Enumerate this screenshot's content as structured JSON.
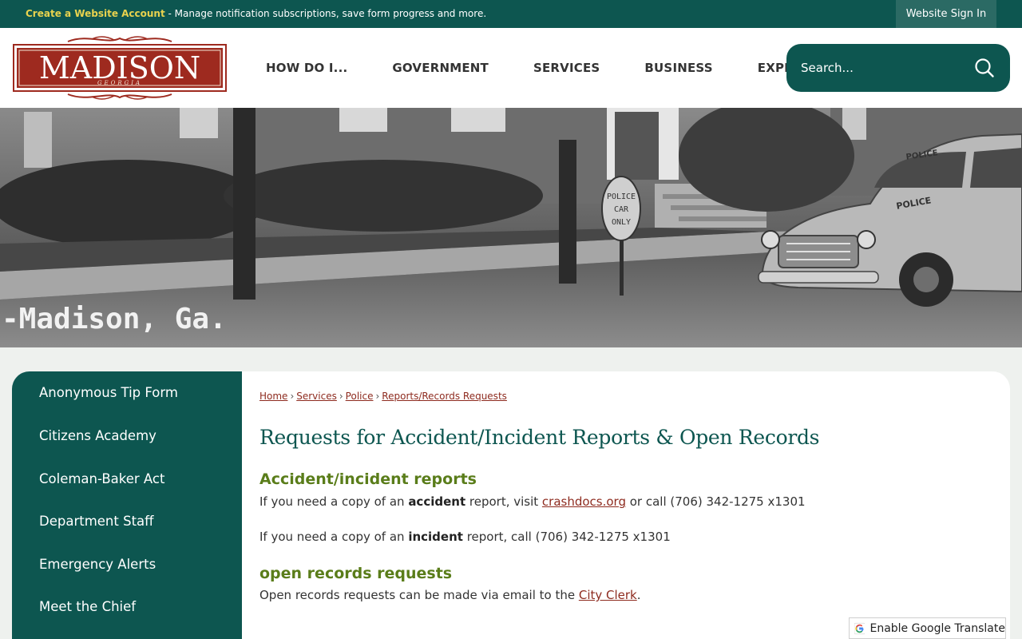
{
  "topbar": {
    "create_account_link": "Create a Website Account",
    "message": " - Manage notification subscriptions, save form progress and more.",
    "sign_in_label": "Website Sign In"
  },
  "logo": {
    "name": "MADISON",
    "subtitle": "GEORGIA",
    "icon": "city-logo"
  },
  "nav": {
    "items": [
      {
        "label": "HOW DO I..."
      },
      {
        "label": "GOVERNMENT"
      },
      {
        "label": "SERVICES"
      },
      {
        "label": "BUSINESS"
      },
      {
        "label": "EXPLORE"
      }
    ]
  },
  "search": {
    "placeholder": "Search...",
    "icon": "search-icon"
  },
  "hero": {
    "caption": "-Madison, Ga.",
    "sign_text": "POLICE CAR ONLY",
    "car_text": "POLICE"
  },
  "sidebar": {
    "items": [
      {
        "label": "Anonymous Tip Form"
      },
      {
        "label": "Citizens Academy"
      },
      {
        "label": "Coleman-Baker Act"
      },
      {
        "label": "Department Staff"
      },
      {
        "label": "Emergency Alerts"
      },
      {
        "label": "Meet the Chief"
      }
    ]
  },
  "breadcrumb": {
    "items": [
      {
        "label": "Home"
      },
      {
        "label": "Services"
      },
      {
        "label": "Police"
      },
      {
        "label": "Reports/Records Requests"
      }
    ],
    "separator": "›"
  },
  "main": {
    "title": "Requests for Accident/Incident Reports & Open Records",
    "section1": {
      "heading": "Accident/incident reports",
      "p1_pre": "If you need a copy of an ",
      "p1_bold": "accident",
      "p1_mid": " report, visit ",
      "p1_link": "crashdocs.org",
      "p1_post": " or call (706) 342-1275 x1301",
      "p2_pre": "If you need a copy of an ",
      "p2_bold": "incident",
      "p2_post": " report, call (706) 342-1275 x1301"
    },
    "section2": {
      "heading": "open records requests",
      "p_pre": "Open records requests can be made via email to the ",
      "p_link": "City Clerk",
      "p_post": "."
    }
  },
  "translate": {
    "label": "Enable Google Translate",
    "icon": "google-translate-icon"
  },
  "colors": {
    "brand_teal": "#0d5650",
    "accent_gold": "#e8d24e",
    "link_red": "#8e2b1f",
    "heading_green": "#5a7d1a",
    "logo_red": "#9e2a1f"
  }
}
